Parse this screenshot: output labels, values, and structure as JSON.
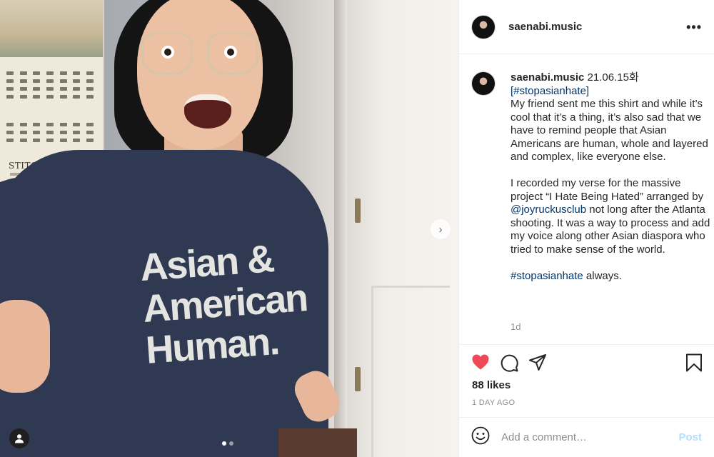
{
  "post": {
    "username": "saenabi.music",
    "more_label": "•••",
    "caption": {
      "username": "saenabi.music",
      "date": "21.06.15화",
      "hashtag1": "[#stopasianhate]",
      "para1": "My friend sent me this shirt and while it’s cool that it’s a thing, it’s also sad that we have to remind people that Asian Americans are human, whole and layered and complex, like everyone else.",
      "para2_a": "I recorded my verse for the massive project “I Hate Being Hated” arranged by ",
      "mention": "@joyruckusclub",
      "para2_b": " not long after the Atlanta shooting. It was a way to process and add my voice along other Asian diaspora who tried to make sense of the world.",
      "closing_tag": "#stopasianhate",
      "closing_text": " always."
    },
    "age": "1d",
    "likes": "88 likes",
    "posted": "1 DAY AGO",
    "comment_placeholder": "Add a comment…",
    "post_label": "Post",
    "liked": true,
    "like_color": "#ed4956",
    "link_color": "#00376b"
  },
  "photo": {
    "shirt_line1": "Asian &",
    "shirt_line2": "American",
    "shirt_line3": "Human.",
    "calendar_title": "STITCH WIZ",
    "carousel": {
      "current": 1,
      "total": 2
    },
    "next_icon": "chevron-right-icon",
    "tag_icon": "user-icon"
  }
}
